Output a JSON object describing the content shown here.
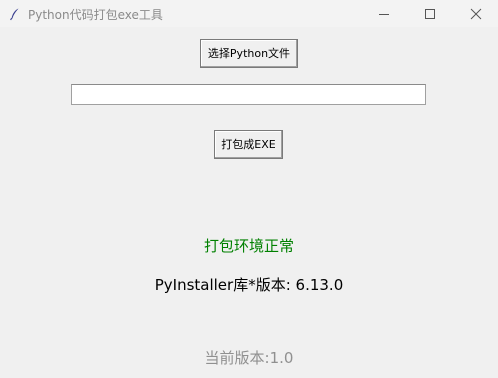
{
  "window": {
    "title": "Python代码打包exe工具",
    "icon": "feather-icon",
    "controls": {
      "minimize_icon": "minimize-icon",
      "maximize_icon": "maximize-icon",
      "close_icon": "close-icon"
    }
  },
  "main": {
    "select_button_label": "选择Python文件",
    "file_path_value": "",
    "pack_button_label": "打包成EXE",
    "status_text": "打包环境正常",
    "status_color": "#008000",
    "pyinstaller_version_text": "PyInstaller库*版本: 6.13.0",
    "current_version_text": "当前版本:1.0"
  }
}
